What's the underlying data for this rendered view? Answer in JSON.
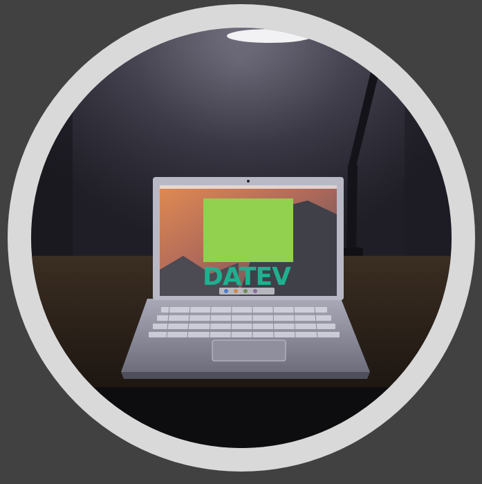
{
  "logo": {
    "text": "DATEV",
    "accent_color": "#92d050",
    "text_color": "#1fb08f"
  },
  "colors": {
    "background": "#414141",
    "ring": "#d9d9d9"
  }
}
